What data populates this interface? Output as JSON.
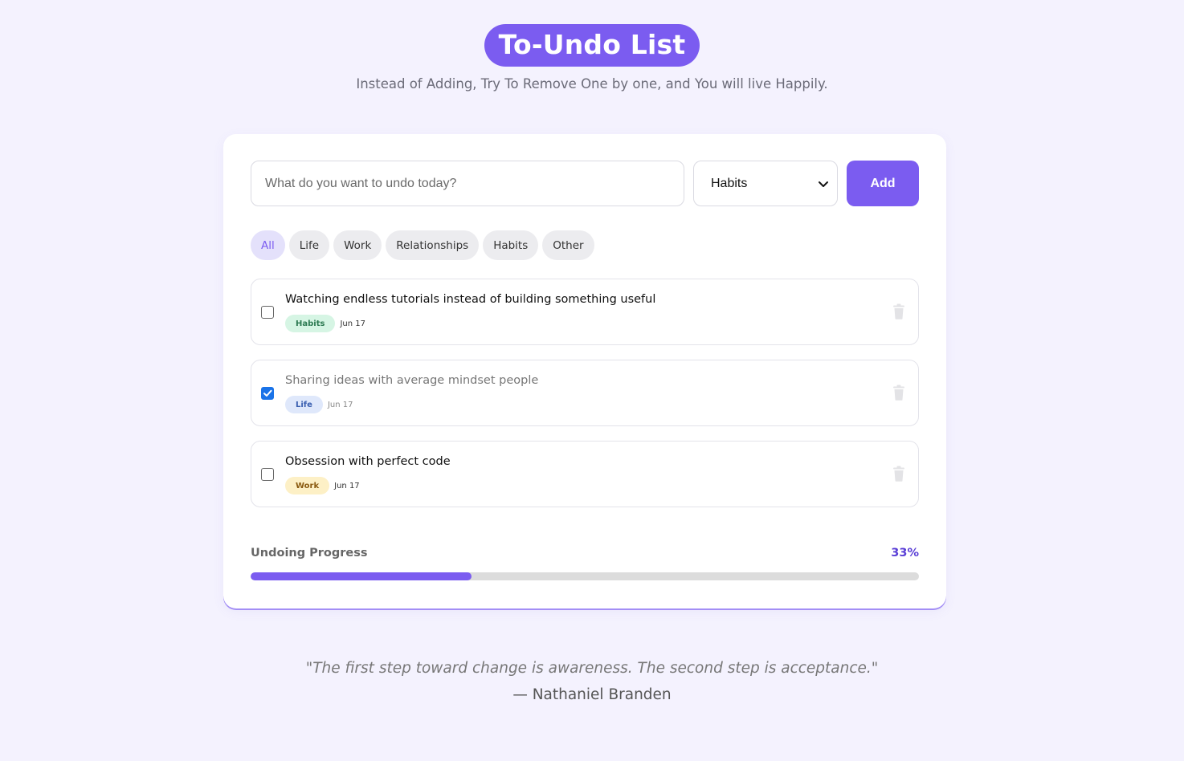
{
  "header": {
    "title": "To-Undo List",
    "subtitle": "Instead of Adding, Try To Remove One by one, and You will live Happily."
  },
  "form": {
    "input_placeholder": "What do you want to undo today?",
    "input_value": "",
    "category_selected": "Habits",
    "add_label": "Add"
  },
  "filters": [
    "All",
    "Life",
    "Work",
    "Relationships",
    "Habits",
    "Other"
  ],
  "active_filter": "All",
  "items": [
    {
      "text": "Watching endless tutorials instead of building something useful",
      "category": "Habits",
      "date": "Jun 17",
      "done": false,
      "tag_bg": "#d6f5e4",
      "tag_color": "#2d7a52"
    },
    {
      "text": "Sharing ideas with average mindset people",
      "category": "Life",
      "date": "Jun 17",
      "done": true,
      "tag_bg": "#dfe8fb",
      "tag_color": "#3a5fb0"
    },
    {
      "text": "Obsession with perfect code",
      "category": "Work",
      "date": "Jun 17",
      "done": false,
      "tag_bg": "#fdf0c6",
      "tag_color": "#8a5a10"
    }
  ],
  "progress": {
    "label": "Undoing Progress",
    "percent_text": "33%",
    "fraction": 0.33
  },
  "quote": {
    "text": "\"The first step toward change is awareness. The second step is acceptance.\"",
    "author": "— Nathaniel Branden"
  },
  "colors": {
    "accent": "#7b5cf0",
    "background": "#f4f2fe"
  },
  "icons": {
    "delete": "trash-icon",
    "select": "chevron-down-icon",
    "check": "checkmark-icon"
  }
}
